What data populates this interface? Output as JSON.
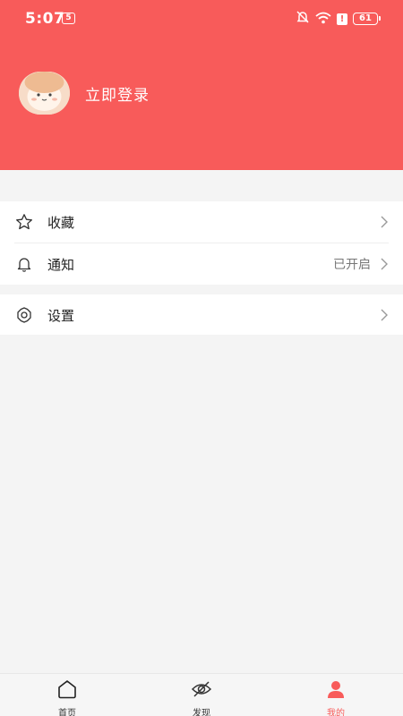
{
  "status_bar": {
    "time": "5:07",
    "app_badge": "5",
    "battery": "61"
  },
  "profile": {
    "login_text": "立即登录"
  },
  "menu": {
    "favorites": {
      "label": "收藏"
    },
    "notifications": {
      "label": "通知",
      "value": "已开启"
    },
    "settings": {
      "label": "设置"
    }
  },
  "tabbar": {
    "home": {
      "label": "首页",
      "icon": "home-icon"
    },
    "discover": {
      "label": "发现",
      "icon": "eye-icon"
    },
    "mine": {
      "label": "我的",
      "icon": "user-icon",
      "active": true
    }
  },
  "colors": {
    "brand": "#f85b5a",
    "background": "#f4f4f4"
  }
}
